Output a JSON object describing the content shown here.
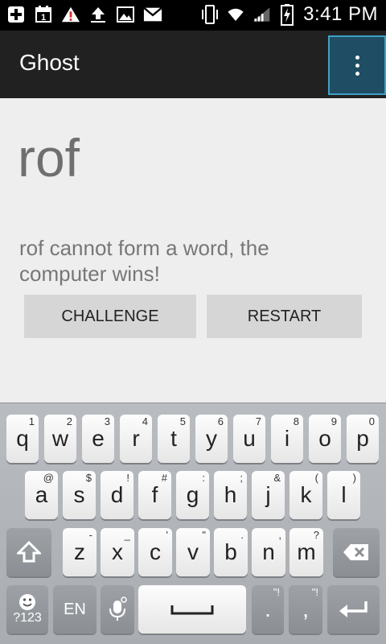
{
  "status_bar": {
    "time": "3:41 PM",
    "icons": [
      "plus-box-icon",
      "calendar-icon",
      "warning-icon",
      "upload-icon",
      "image-icon",
      "gmail-icon",
      "vibrate-icon",
      "wifi-icon",
      "signal-icon",
      "battery-charging-icon"
    ],
    "calendar_day": "1"
  },
  "action_bar": {
    "title": "Ghost",
    "overflow_icon": "more-vert-icon"
  },
  "game": {
    "word": "rof",
    "status": "rof cannot form a word, the computer wins!",
    "challenge_label": "CHALLENGE",
    "restart_label": "RESTART"
  },
  "keyboard": {
    "row1": [
      {
        "key": "q",
        "hint": "1"
      },
      {
        "key": "w",
        "hint": "2"
      },
      {
        "key": "e",
        "hint": "3"
      },
      {
        "key": "r",
        "hint": "4"
      },
      {
        "key": "t",
        "hint": "5"
      },
      {
        "key": "y",
        "hint": "6"
      },
      {
        "key": "u",
        "hint": "7"
      },
      {
        "key": "i",
        "hint": "8"
      },
      {
        "key": "o",
        "hint": "9"
      },
      {
        "key": "p",
        "hint": "0"
      }
    ],
    "row2": [
      {
        "key": "a",
        "hint": "@"
      },
      {
        "key": "s",
        "hint": "$"
      },
      {
        "key": "d",
        "hint": "!"
      },
      {
        "key": "f",
        "hint": "#"
      },
      {
        "key": "g",
        "hint": ":"
      },
      {
        "key": "h",
        "hint": ";"
      },
      {
        "key": "j",
        "hint": "&"
      },
      {
        "key": "k",
        "hint": "("
      },
      {
        "key": "l",
        "hint": ")"
      }
    ],
    "row3": [
      {
        "key": "z",
        "hint": "-"
      },
      {
        "key": "x",
        "hint": "_"
      },
      {
        "key": "c",
        "hint": "'"
      },
      {
        "key": "v",
        "hint": "\""
      },
      {
        "key": "b",
        "hint": "."
      },
      {
        "key": "n",
        "hint": ","
      },
      {
        "key": "m",
        "hint": "?"
      }
    ],
    "symbols_label": "?123",
    "language_label": "EN",
    "period": ".",
    "period_hint": "\"!",
    "comma": ",",
    "comma_hint": "\"!"
  }
}
